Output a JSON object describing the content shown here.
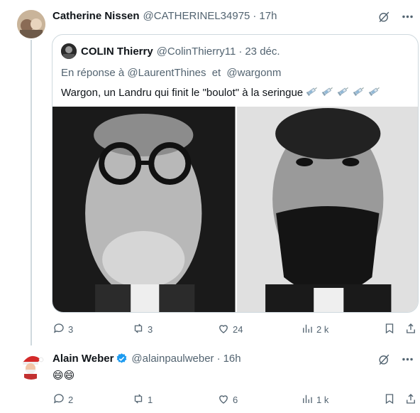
{
  "tweet1": {
    "author_name": "Catherine Nissen",
    "handle": "@CATHERINEL34975",
    "separator": "·",
    "time": "17h",
    "quote": {
      "author_name": "COLIN Thierry",
      "handle": "@ColinThierry11",
      "separator": "·",
      "time": "23 déc.",
      "reply_prefix": "En réponse à",
      "reply_user1": "@LaurentThines",
      "reply_conj": "et",
      "reply_user2": "@wargonm",
      "text": "Wargon, un Landru qui finit le \"boulot\" à la seringue",
      "syringe_count": 5
    },
    "stats": {
      "replies": "3",
      "reposts": "3",
      "likes": "24",
      "views": "2 k"
    }
  },
  "tweet2": {
    "author_name": "Alain Weber",
    "handle": "@alainpaulweber",
    "separator": "·",
    "time": "16h",
    "text": "😄😄",
    "stats": {
      "replies": "2",
      "reposts": "1",
      "likes": "6",
      "views": "1 k"
    }
  },
  "colors": {
    "accent": "#1d9bf0",
    "muted": "#536471",
    "border": "#cfd9de",
    "text": "#0f1419"
  },
  "icons": [
    "grok-slash-icon",
    "more-options-icon",
    "reply-icon",
    "repost-icon",
    "like-icon",
    "views-icon",
    "bookmark-icon",
    "share-icon",
    "verified-badge-icon",
    "syringe-icon"
  ]
}
